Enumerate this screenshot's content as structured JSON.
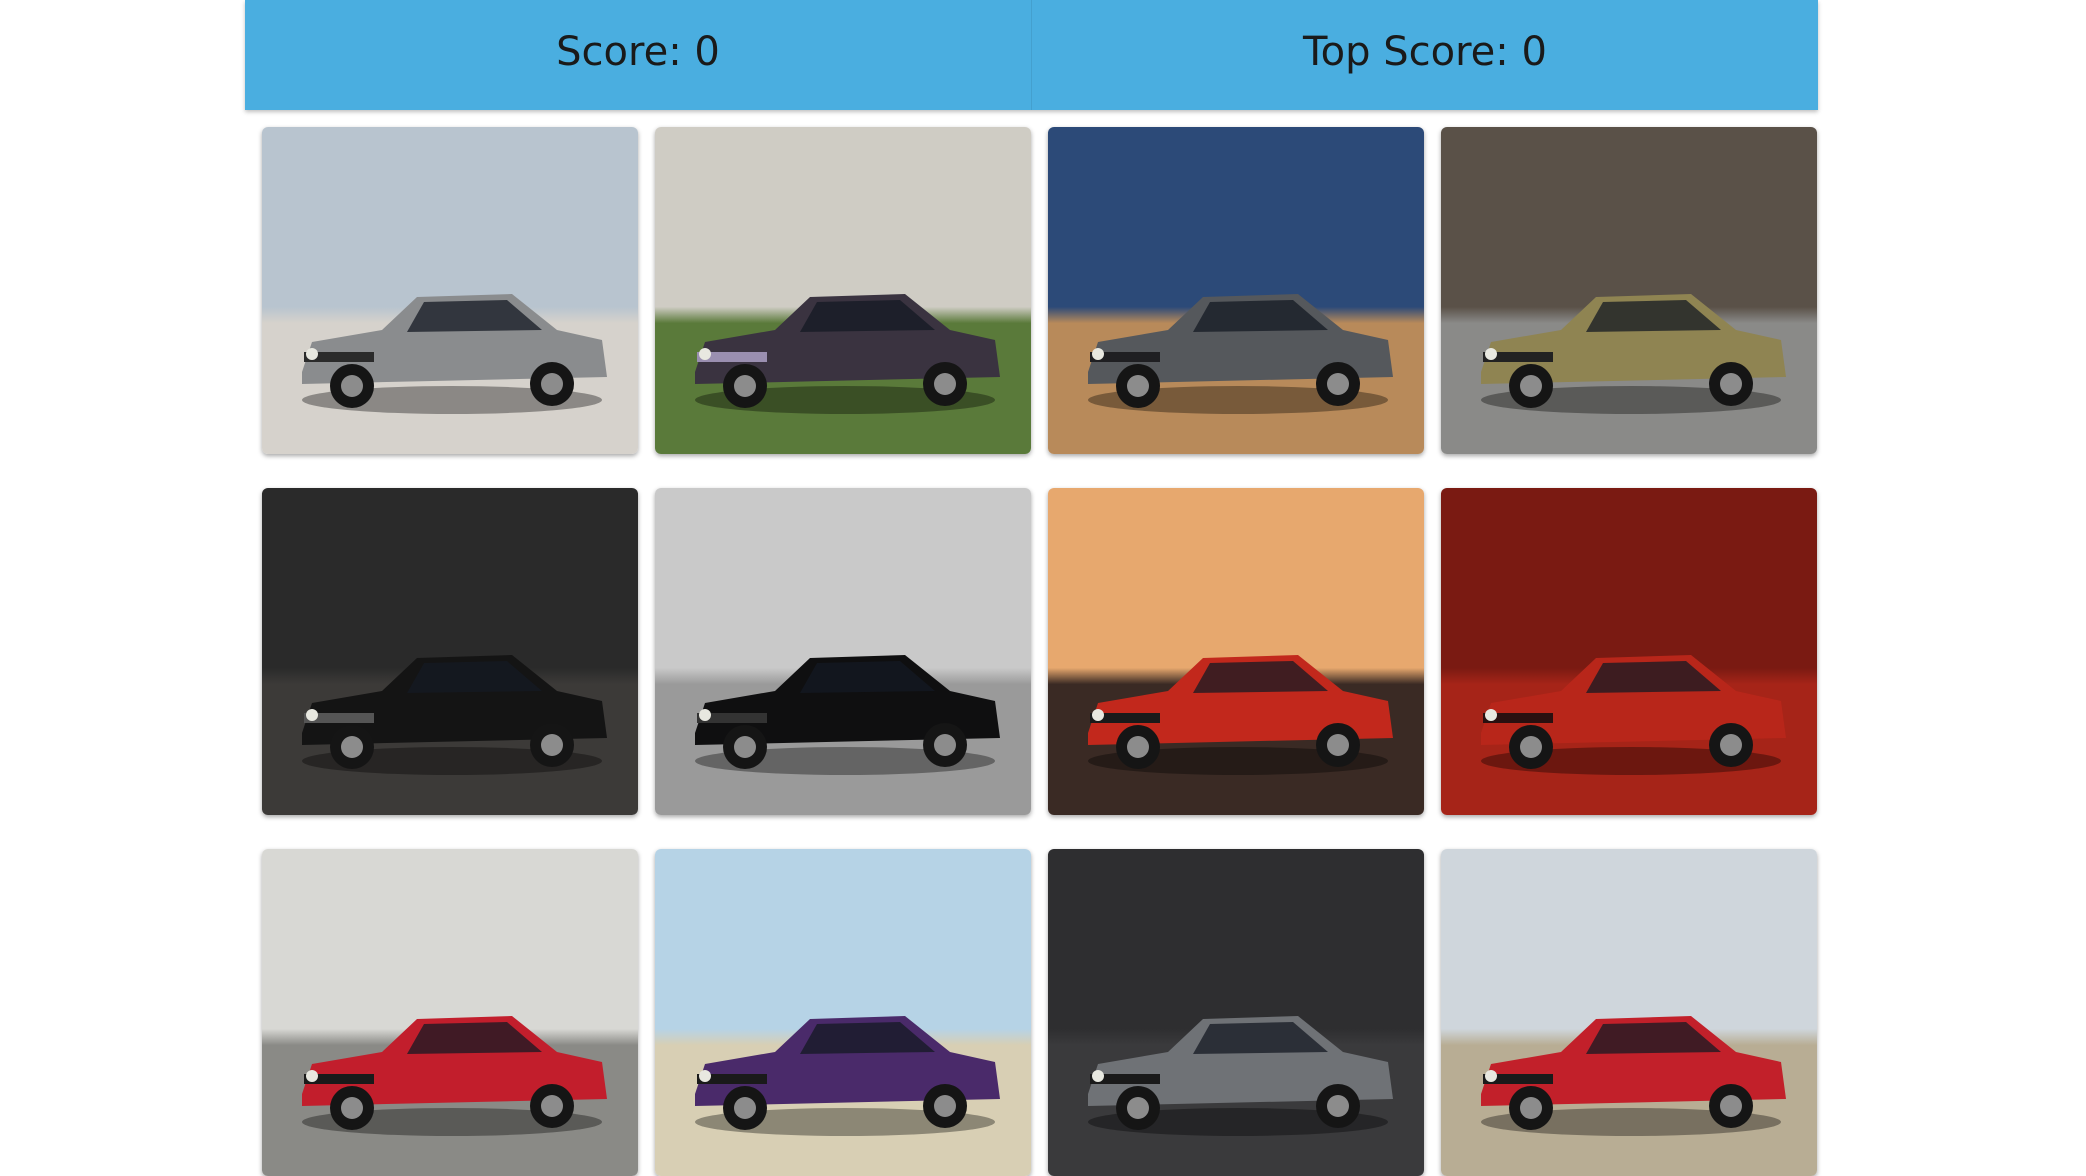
{
  "header": {
    "score_label": "Score: 0",
    "top_score_label": "Top Score: 0"
  },
  "cards": [
    {
      "id": "card-1",
      "sky": "#b8c4cf",
      "ground": "#d6d2cc",
      "car": "#8a8c8e",
      "stripe": "#2b2b2b",
      "scene": "bridge"
    },
    {
      "id": "card-2",
      "sky": "#cfccc4",
      "ground": "#5a7a3a",
      "car": "#3a3340",
      "stripe": "#9a8fb0",
      "scene": "field"
    },
    {
      "id": "card-3",
      "sky": "#2c4a78",
      "ground": "#b88a5a",
      "car": "#55585c",
      "stripe": "#1f1f22",
      "scene": "desert"
    },
    {
      "id": "card-4",
      "sky": "#5a5148",
      "ground": "#8a8a88",
      "car": "#8f8452",
      "stripe": "#222222",
      "scene": "cliff"
    },
    {
      "id": "card-5",
      "sky": "#2a2a2a",
      "ground": "#3c3a38",
      "car": "#141414",
      "stripe": "#555555",
      "scene": "garage"
    },
    {
      "id": "card-6",
      "sky": "#c9c9c9",
      "ground": "#9a9a9a",
      "car": "#0f0f10",
      "stripe": "#333333",
      "scene": "studio"
    },
    {
      "id": "card-7",
      "sky": "#e7a86e",
      "ground": "#3a2a24",
      "car": "#c2281c",
      "stripe": "#1a1a1a",
      "scene": "track"
    },
    {
      "id": "card-8",
      "sky": "#7a1a12",
      "ground": "#a62418",
      "car": "#b8261a",
      "stripe": "#2a1010",
      "scene": "closeup"
    },
    {
      "id": "card-9",
      "sky": "#d8d8d4",
      "ground": "#8a8a86",
      "car": "#c21e2c",
      "stripe": "#1a1a1a",
      "scene": "street"
    },
    {
      "id": "card-10",
      "sky": "#b6d3e6",
      "ground": "#d8cfb4",
      "car": "#4a2a6a",
      "stripe": "#1a1a1a",
      "scene": "beach"
    },
    {
      "id": "card-11",
      "sky": "#2e2e30",
      "ground": "#3a3a3c",
      "car": "#6f7276",
      "stripe": "#1a1a1a",
      "scene": "night"
    },
    {
      "id": "card-12",
      "sky": "#cfd6dc",
      "ground": "#b8ad94",
      "car": "#c2202a",
      "stripe": "#1a1a1a",
      "scene": "coast"
    }
  ]
}
